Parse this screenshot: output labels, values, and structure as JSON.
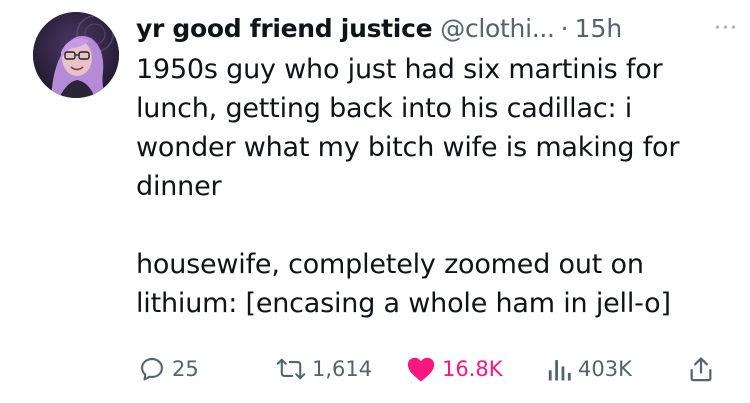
{
  "tweet": {
    "author_name": "yr good friend justice",
    "handle": "@clothi...",
    "separator": "·",
    "time": "15h",
    "more_label": "···",
    "paragraphs": [
      "1950s guy who just had six martinis for lunch, getting back into his cadillac: i wonder what my bitch wife is making for dinner",
      "housewife, completely zoomed out on lithium: [encasing a whole ham in jell-o]"
    ],
    "line_breaks_note": ""
  },
  "actions": {
    "replies": "25",
    "retweets": "1,614",
    "likes": "16.8K",
    "views": "403K"
  },
  "colors": {
    "text": "#0f1419",
    "secondary": "#536471",
    "like": "#f91880"
  },
  "icons": {
    "reply": "reply-icon",
    "retweet": "retweet-icon",
    "like": "heart-icon",
    "views": "views-icon",
    "share": "share-icon",
    "more": "more-icon"
  }
}
